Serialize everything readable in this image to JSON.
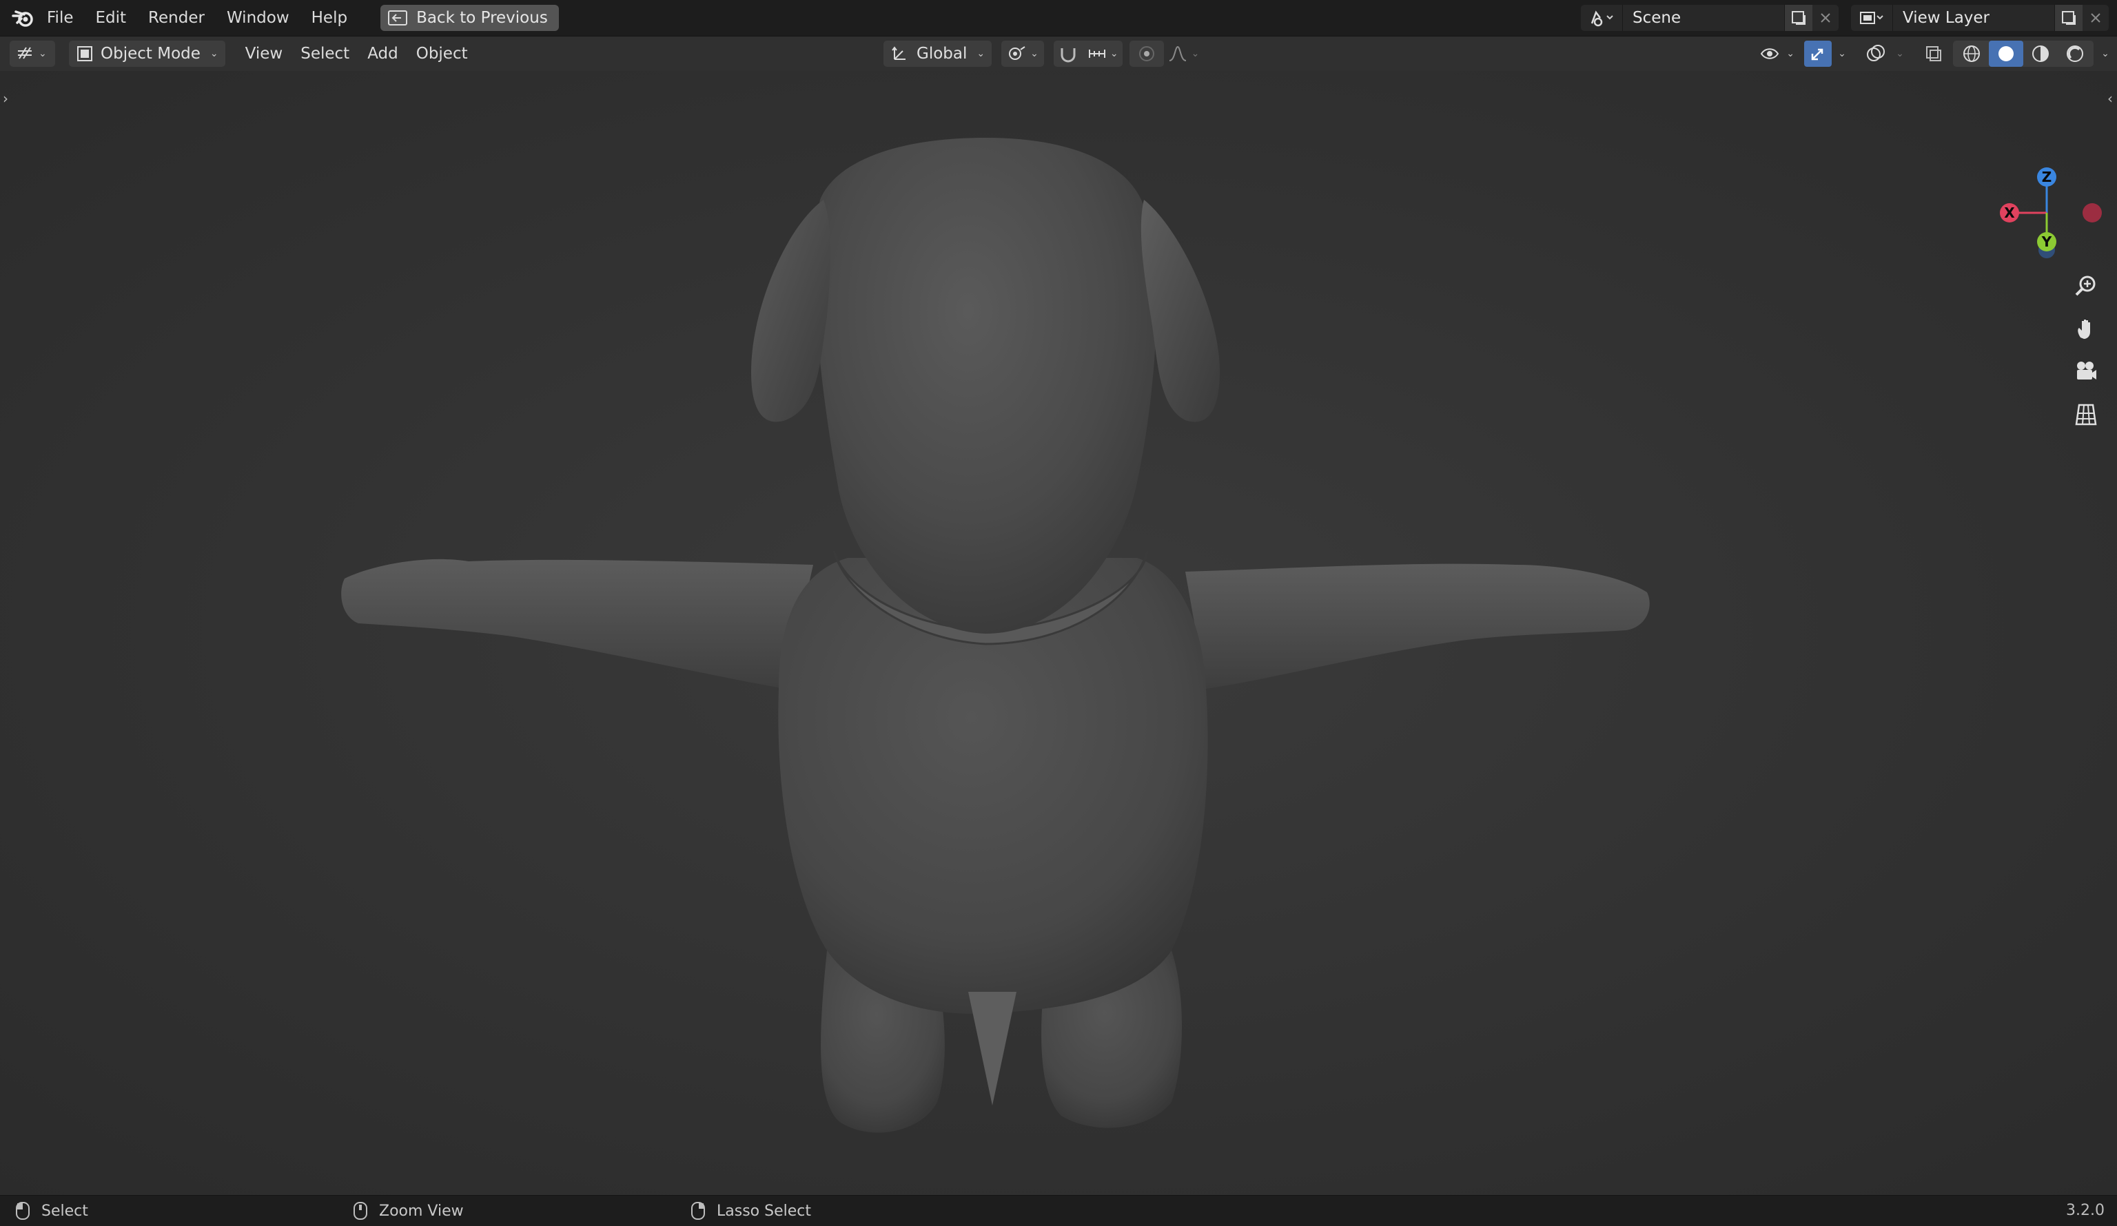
{
  "topbar": {
    "menu": [
      "File",
      "Edit",
      "Render",
      "Window",
      "Help"
    ],
    "back_button": "Back to Previous",
    "scene_label": "Scene",
    "view_layer_label": "View Layer"
  },
  "header": {
    "mode": "Object Mode",
    "menus": [
      "View",
      "Select",
      "Add",
      "Object"
    ],
    "transform_orientation": "Global"
  },
  "gizmo": {
    "z": "Z",
    "x": "X",
    "y": "Y"
  },
  "statusbar": {
    "left_action": "Select",
    "middle_action": "Zoom View",
    "right_action": "Lasso Select",
    "version": "3.2.0"
  },
  "colors": {
    "axis_x": "#e0425e",
    "axis_y": "#8cca33",
    "axis_z": "#3a86e0",
    "accent_blue": "#4772b3"
  },
  "icons": [
    "blender-logo-icon",
    "back-icon",
    "scene-icon",
    "copy-icon",
    "close-icon",
    "view-layer-icon",
    "editor-type-icon",
    "object-mode-icon",
    "orientation-icon",
    "pivot-icon",
    "snap-icon",
    "snap-increment-icon",
    "proportional-editing-icon",
    "falloff-icon",
    "visibility-icon",
    "gizmo-icon",
    "overlay-icon",
    "xray-icon",
    "wireframe-shading-icon",
    "solid-shading-icon",
    "material-shading-icon",
    "rendered-shading-icon",
    "zoom-icon",
    "hand-pan-icon",
    "camera-icon",
    "grid-perspective-icon",
    "mouse-left-icon",
    "mouse-middle-icon",
    "mouse-right-icon"
  ]
}
